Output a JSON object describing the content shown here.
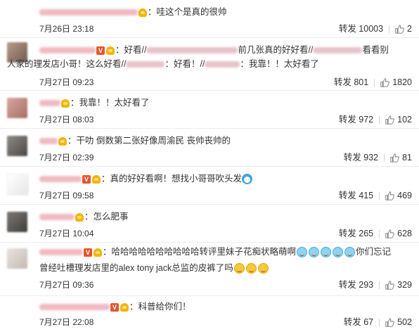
{
  "comments": [
    {
      "segments": [
        "：哇这个是真的很帅"
      ],
      "time": "7月26日 23:18",
      "repost": "转发 10003",
      "likes": "2"
    },
    {
      "segments": [
        "：好看//",
        "前几张真的好好看//",
        "看看别",
        "人家的理发店小哥！这么好看//",
        "：好看！//",
        "：我靠！！太好看了"
      ],
      "time": "7月27日 09:23",
      "repost": "转发 801",
      "likes": "1820"
    },
    {
      "segments": [
        "：我靠！！太好看了"
      ],
      "time": "7月27日 08:03",
      "repost": "转发 972",
      "likes": "102"
    },
    {
      "segments": [
        "：干叻 倒数第二张好像周渝民 丧帅丧帅的"
      ],
      "time": "7月27日 02:39",
      "repost": "转发 932",
      "likes": "81"
    },
    {
      "segments": [
        "：真的好好看啊！想找小哥哥吹头发"
      ],
      "time": "7月27日 09:58",
      "repost": "转发 415",
      "likes": "469"
    },
    {
      "segments": [
        "：怎么肥事"
      ],
      "time": "7月27日 10:04",
      "repost": "转发 265",
      "likes": "628"
    },
    {
      "segments": [
        "：哈哈哈哈哈哈哈哈哈哈转评里妹子花痴状略萌啊",
        "你们忘记",
        "曾经吐槽理发店里的alex tony jack总监的皮裤了吗"
      ],
      "time": "7月27日 09:36",
      "repost": "转发 293",
      "likes": "329"
    },
    {
      "segments": [
        "：科普给你们！"
      ],
      "time": "7月27日 22:08",
      "repost": "转发 67",
      "likes": "502"
    }
  ],
  "icons": {
    "thumb": "thumbs-up-icon",
    "vip": "vip-v-badge-icon",
    "crown": "member-crown-icon"
  },
  "colors": {
    "vip_badge": "#e8542b",
    "crown": "#f4b400",
    "divider": "#ececec"
  }
}
